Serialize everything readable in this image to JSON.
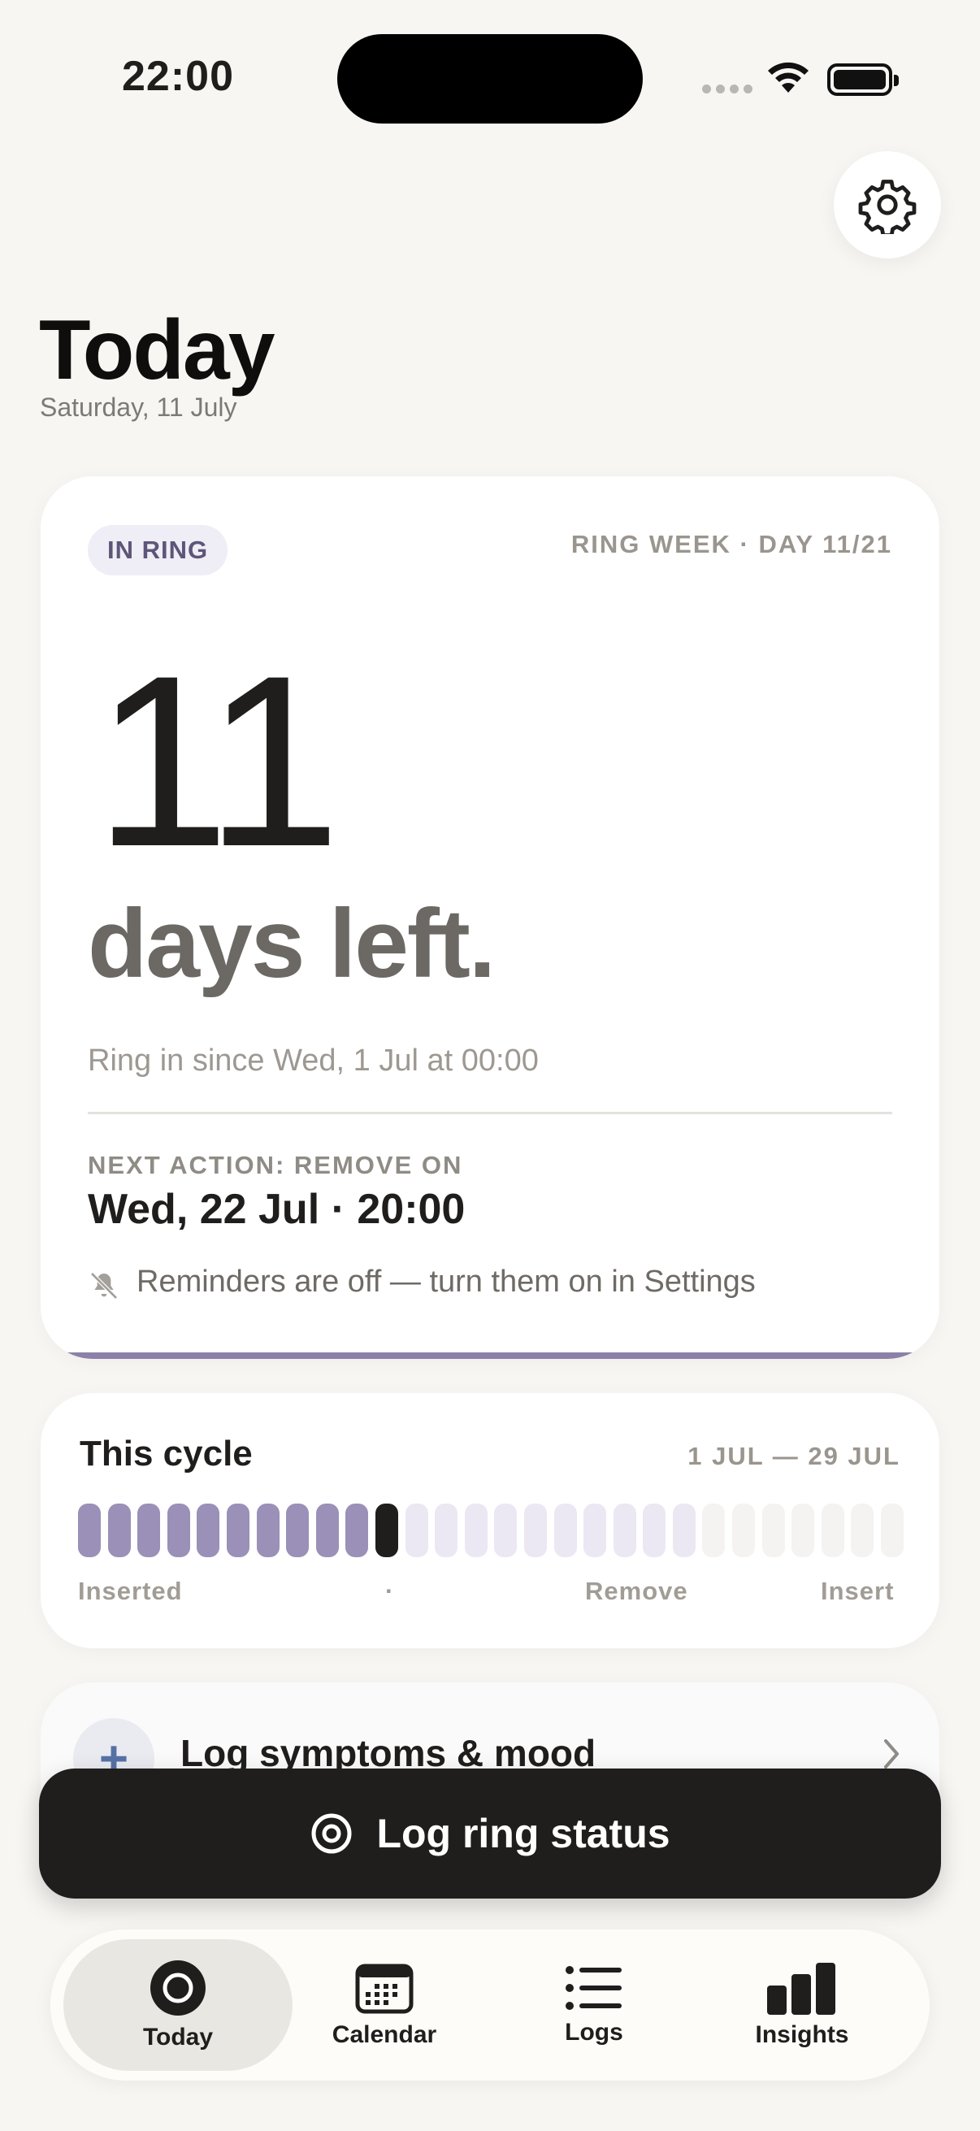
{
  "status_bar": {
    "time": "22:00"
  },
  "header": {
    "title": "Today",
    "date": "Saturday, 11 July"
  },
  "ring_card": {
    "badge": "IN RING",
    "ring_week": "RING WEEK · DAY 11/21",
    "days_number": "11",
    "days_caption": "days left.",
    "since_text": "Ring in since Wed, 1 Jul at 00:00",
    "next_action_label": "NEXT ACTION: REMOVE ON",
    "next_action_value": "Wed, 22 Jul · 20:00",
    "reminder_text": "Reminders are off — turn them on in Settings"
  },
  "cycle": {
    "title": "This cycle",
    "range": "1 JUL — 29 JUL",
    "total_days": 28,
    "ring_days": 21,
    "current_day": 11,
    "labels": {
      "inserted": "Inserted",
      "today_marker": "·",
      "remove": "Remove",
      "insert": "Insert"
    }
  },
  "symptoms": {
    "icon": "plus-icon",
    "label": "Log symptoms & mood"
  },
  "cta": {
    "label": "Log ring status",
    "icon": "ring-target-icon"
  },
  "tabs": [
    {
      "label": "Today",
      "icon": "ring-icon",
      "active": true
    },
    {
      "label": "Calendar",
      "icon": "calendar-icon",
      "active": false
    },
    {
      "label": "Logs",
      "icon": "list-icon",
      "active": false
    },
    {
      "label": "Insights",
      "icon": "bar-chart-icon",
      "active": false
    }
  ],
  "colors": {
    "background": "#f7f6f3",
    "accent": "#9a90b8",
    "accent_light": "#ece8f3",
    "dark": "#1f1e1c"
  }
}
